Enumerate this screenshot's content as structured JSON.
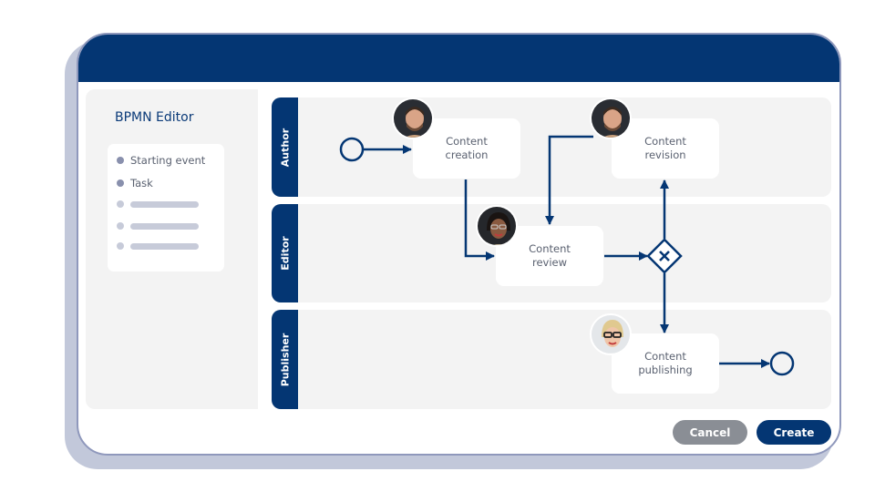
{
  "editor": {
    "title": "BPMN Editor",
    "palette": [
      {
        "label": "Starting event",
        "type": "text"
      },
      {
        "label": "Task",
        "type": "text"
      },
      {
        "label": "",
        "type": "placeholder"
      },
      {
        "label": "",
        "type": "placeholder"
      },
      {
        "label": "",
        "type": "placeholder"
      }
    ]
  },
  "lanes": [
    {
      "label": "Author"
    },
    {
      "label": "Editor"
    },
    {
      "label": "Publisher"
    }
  ],
  "tasks": {
    "creation": {
      "line1": "Content",
      "line2": "creation",
      "assignee": "author-avatar"
    },
    "revision": {
      "line1": "Content",
      "line2": "revision",
      "assignee": "author-avatar"
    },
    "review": {
      "line1": "Content",
      "line2": "review",
      "assignee": "editor-avatar"
    },
    "publishing": {
      "line1": "Content",
      "line2": "publishing",
      "assignee": "publisher-avatar"
    }
  },
  "gateway": {
    "type": "exclusive",
    "icon": "x-icon"
  },
  "buttons": {
    "cancel": "Cancel",
    "create": "Create"
  },
  "colors": {
    "primary": "#043673",
    "cancel": "#8a8e95",
    "lane_bg": "#f3f3f3",
    "shadow": "#c2c8da"
  }
}
